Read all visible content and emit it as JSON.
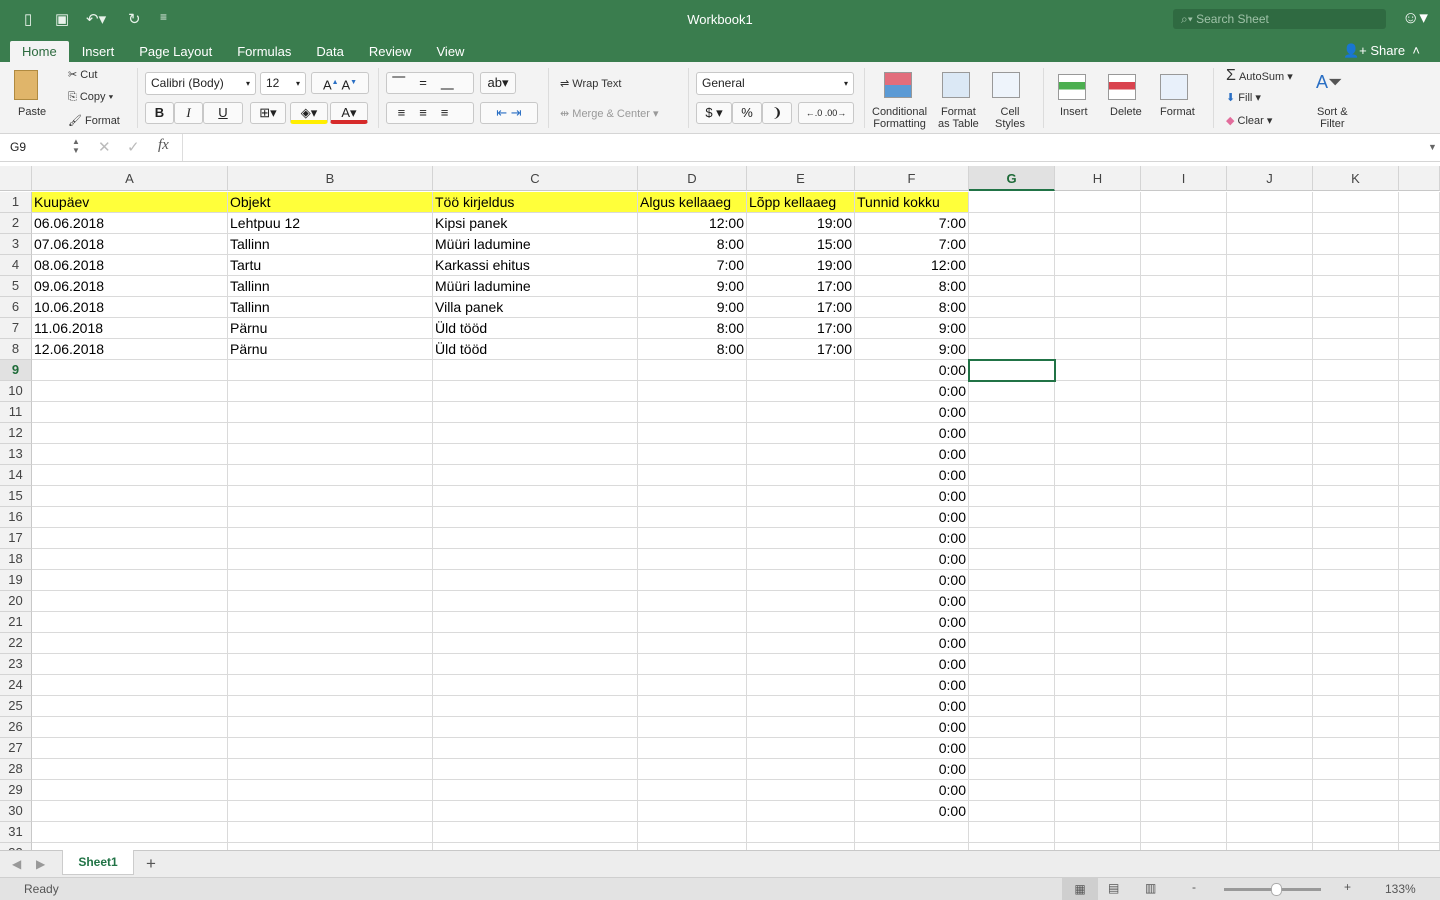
{
  "title": "Workbook1",
  "search_placeholder": "Search Sheet",
  "tabs": [
    "Home",
    "Insert",
    "Page Layout",
    "Formulas",
    "Data",
    "Review",
    "View"
  ],
  "share": "Share",
  "ribbon": {
    "paste": "Paste",
    "cut": "Cut",
    "copy": "Copy",
    "format_painter": "Format",
    "font": "Calibri (Body)",
    "size": "12",
    "bold": "B",
    "italic": "I",
    "underline": "U",
    "wrap": "Wrap Text",
    "merge": "Merge & Center",
    "number_format": "General",
    "currency": "$",
    "percent": "%",
    "comma": "❩",
    "cond1": "Conditional",
    "cond2": "Formatting",
    "fat1": "Format",
    "fat2": "as Table",
    "cs1": "Cell",
    "cs2": "Styles",
    "insert": "Insert",
    "delete": "Delete",
    "format": "Format",
    "autosum": "AutoSum",
    "fill": "Fill",
    "clear": "Clear",
    "sort1": "Sort &",
    "sort2": "Filter"
  },
  "name_box": "G9",
  "formula": "",
  "columns": [
    "A",
    "B",
    "C",
    "D",
    "E",
    "F",
    "G",
    "H",
    "I",
    "J",
    "K"
  ],
  "selected_cell": "G9",
  "rows": [
    [
      "Kuupäev",
      "Objekt",
      "Töö kirjeldus",
      "Algus kellaaeg",
      "Lõpp kellaaeg",
      "Tunnid kokku"
    ],
    [
      "06.06.2018",
      "Lehtpuu 12",
      "Kipsi panek",
      "12:00",
      "19:00",
      "7:00"
    ],
    [
      "07.06.2018",
      "Tallinn",
      "Müüri ladumine",
      "8:00",
      "15:00",
      "7:00"
    ],
    [
      "08.06.2018",
      "Tartu",
      "Karkassi ehitus",
      "7:00",
      "19:00",
      "12:00"
    ],
    [
      "09.06.2018",
      "Tallinn",
      "Müüri ladumine",
      "9:00",
      "17:00",
      "8:00"
    ],
    [
      "10.06.2018",
      "Tallinn",
      "Villa panek",
      "9:00",
      "17:00",
      "8:00"
    ],
    [
      "11.06.2018",
      "Pärnu",
      "Üld tööd",
      "8:00",
      "17:00",
      "9:00"
    ],
    [
      "12.06.2018",
      "Pärnu",
      "Üld tööd",
      "8:00",
      "17:00",
      "9:00"
    ],
    [
      "",
      "",
      "",
      "",
      "",
      "0:00"
    ],
    [
      "",
      "",
      "",
      "",
      "",
      "0:00"
    ],
    [
      "",
      "",
      "",
      "",
      "",
      "0:00"
    ],
    [
      "",
      "",
      "",
      "",
      "",
      "0:00"
    ],
    [
      "",
      "",
      "",
      "",
      "",
      "0:00"
    ],
    [
      "",
      "",
      "",
      "",
      "",
      "0:00"
    ],
    [
      "",
      "",
      "",
      "",
      "",
      "0:00"
    ],
    [
      "",
      "",
      "",
      "",
      "",
      "0:00"
    ],
    [
      "",
      "",
      "",
      "",
      "",
      "0:00"
    ],
    [
      "",
      "",
      "",
      "",
      "",
      "0:00"
    ],
    [
      "",
      "",
      "",
      "",
      "",
      "0:00"
    ],
    [
      "",
      "",
      "",
      "",
      "",
      "0:00"
    ],
    [
      "",
      "",
      "",
      "",
      "",
      "0:00"
    ],
    [
      "",
      "",
      "",
      "",
      "",
      "0:00"
    ],
    [
      "",
      "",
      "",
      "",
      "",
      "0:00"
    ],
    [
      "",
      "",
      "",
      "",
      "",
      "0:00"
    ],
    [
      "",
      "",
      "",
      "",
      "",
      "0:00"
    ],
    [
      "",
      "",
      "",
      "",
      "",
      "0:00"
    ],
    [
      "",
      "",
      "",
      "",
      "",
      "0:00"
    ],
    [
      "",
      "",
      "",
      "",
      "",
      "0:00"
    ],
    [
      "",
      "",
      "",
      "",
      "",
      "0:00"
    ],
    [
      "",
      "",
      "",
      "",
      "",
      "0:00"
    ],
    [
      "",
      "",
      "",
      "",
      "",
      ""
    ]
  ],
  "sheet_tab": "Sheet1",
  "status": "Ready",
  "zoom": "133%",
  "colors": {
    "accent": "#217346",
    "title_bg": "#3a7d4e",
    "header_fill": "#ffff3a"
  }
}
